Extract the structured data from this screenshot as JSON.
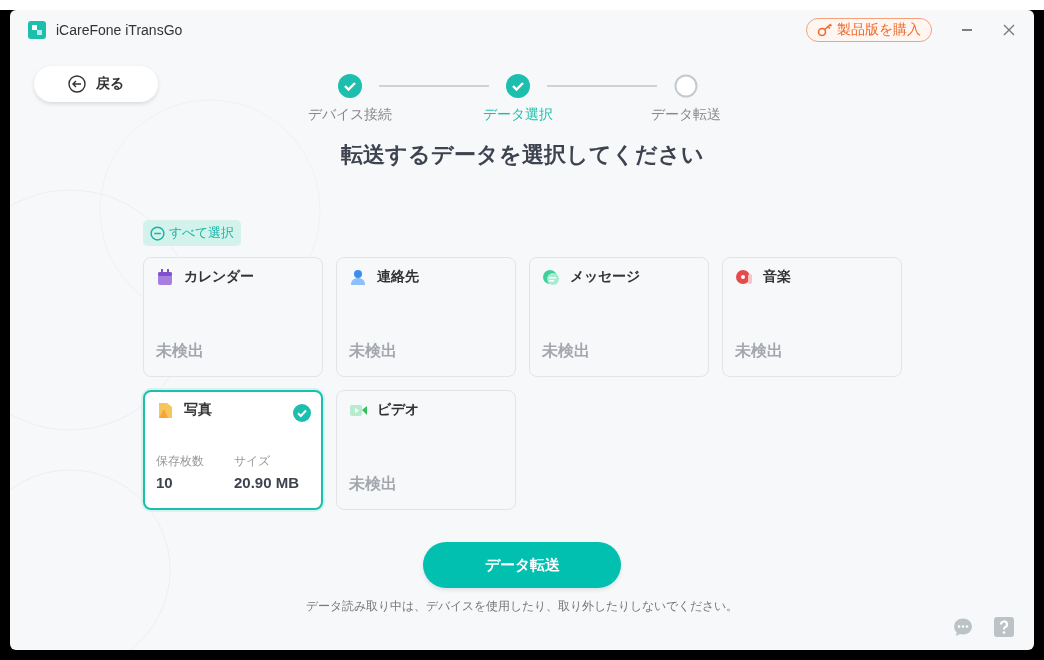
{
  "window": {
    "title": "iCareFone iTransGo"
  },
  "buy_button": {
    "label": "製品版を購入"
  },
  "back_button": {
    "label": "戻る"
  },
  "steps": [
    {
      "label": "デバイス接続",
      "completed": true,
      "selected": false
    },
    {
      "label": "データ選択",
      "completed": true,
      "selected": true
    },
    {
      "label": "データ転送",
      "completed": false,
      "selected": false
    }
  ],
  "heading": "転送するデータを選択してください",
  "select_all": {
    "label": "すべて選択",
    "checked": false
  },
  "categories": [
    {
      "name": "カレンダー",
      "kind": "empty",
      "status": "未検出",
      "selected": false
    },
    {
      "name": "連絡先",
      "kind": "empty",
      "status": "未検出",
      "selected": false
    },
    {
      "name": "メッセージ",
      "kind": "empty",
      "status": "未検出",
      "selected": false
    },
    {
      "name": "音楽",
      "kind": "empty",
      "status": "未検出",
      "selected": false
    },
    {
      "name": "写真",
      "kind": "stats",
      "stats": [
        {
          "label": "保存枚数",
          "value": "10"
        },
        {
          "label": "サイズ",
          "value": "20.90 MB"
        }
      ],
      "selected": true
    },
    {
      "name": "ビデオ",
      "kind": "empty",
      "status": "未検出",
      "selected": false
    }
  ],
  "transfer_button": {
    "label": "データ転送"
  },
  "note": "データ読み取り中は、デバイスを使用したり、取り外したりしないでください。"
}
